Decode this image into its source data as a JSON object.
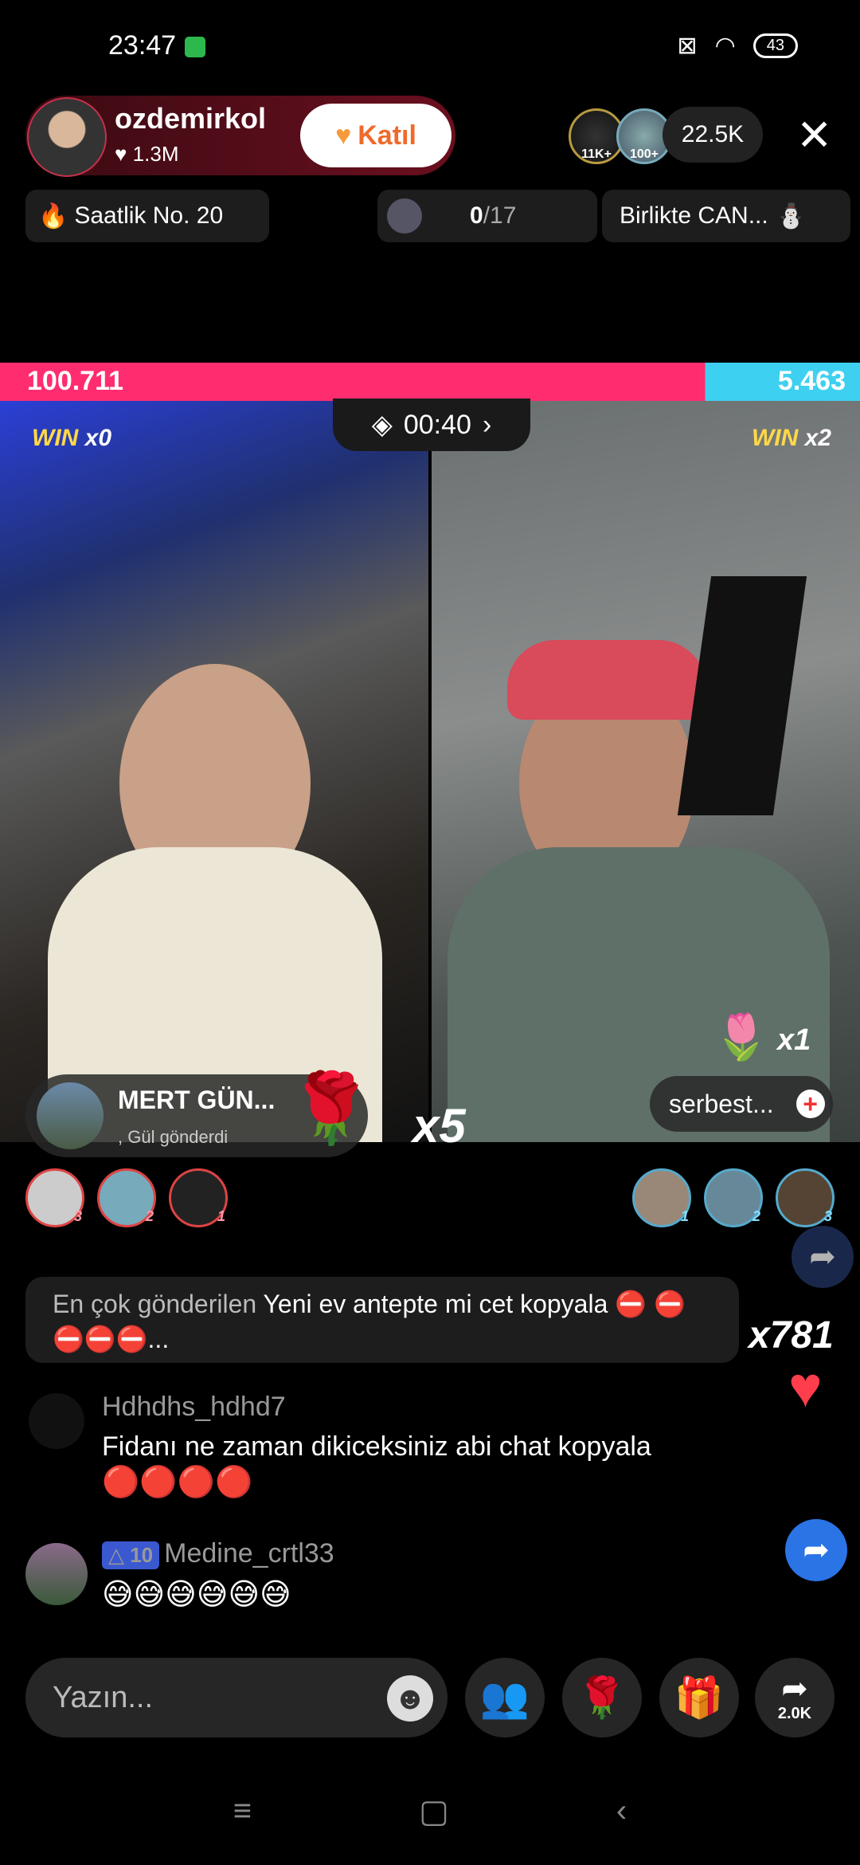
{
  "status_bar": {
    "time": "23:47",
    "battery": "43"
  },
  "host": {
    "name": "ozdemirkol",
    "likes": "1.3M",
    "join_label": "Katıl"
  },
  "viewers": {
    "badge1": "11K+",
    "badge2": "100+",
    "count": "22.5K"
  },
  "pills": {
    "hourly": "Saatlik No. 20",
    "progress": "0",
    "progress_total": "/17",
    "together": "Birlikte CAN..."
  },
  "battle": {
    "score_left": "100.711",
    "score_right": "5.463",
    "timer": "00:40",
    "win_left": "x0",
    "win_right": "x2",
    "win_word": "WIN"
  },
  "gift_banner": {
    "name": "MERT GÜN...",
    "subtitle": ", Gül gönderdi",
    "count": "x5"
  },
  "right_gift": {
    "count": "x1",
    "user": "serbest..."
  },
  "rank_left": [
    "3",
    "2",
    "1"
  ],
  "rank_right": [
    "1",
    "2",
    "3"
  ],
  "top_gift": {
    "prefix": "En çok gönderilen",
    "text": "Yeni ev antepte mi cet kopyala ⛔ ⛔⛔⛔⛔...",
    "count": "x781"
  },
  "comments": [
    {
      "user": "Hdhdhs_hdhd7",
      "message": "Fidanı ne zaman dikiceksiniz abi chat kopyala",
      "emojis": "🔴🔴🔴🔴"
    },
    {
      "user": "Medine_crtl33",
      "level": "10",
      "message": "😅😅😅😅😅😅"
    }
  ],
  "input": {
    "placeholder": "Yazın..."
  },
  "share_count": "2.0K"
}
